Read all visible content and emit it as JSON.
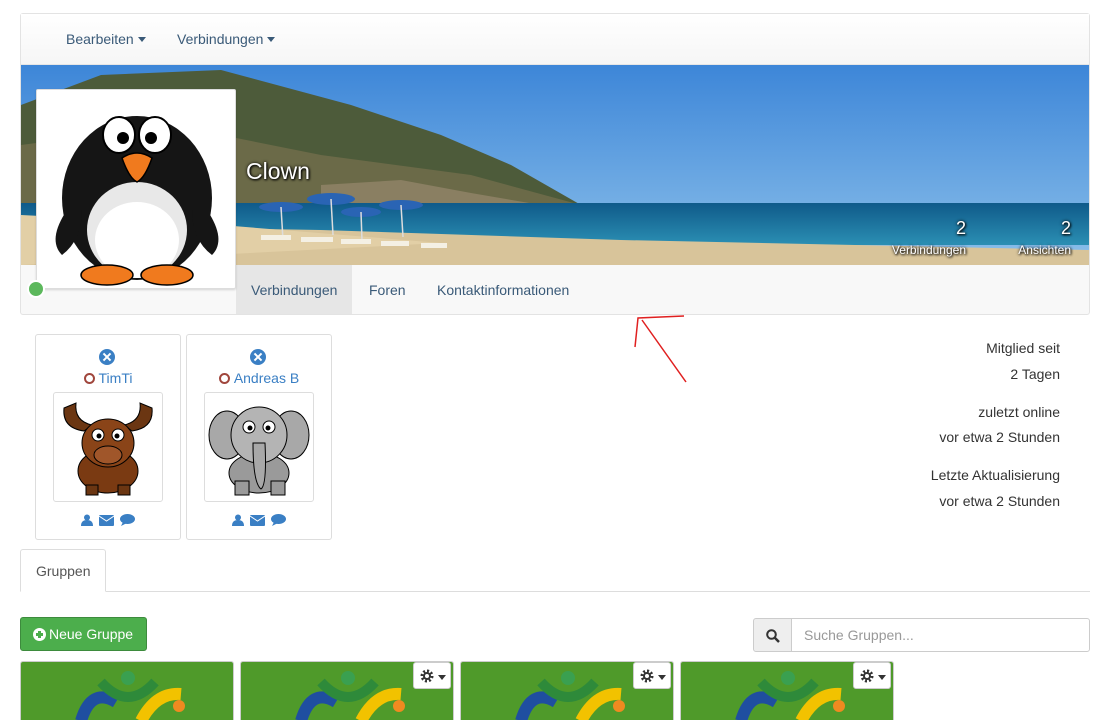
{
  "topmenu": {
    "edit_label": "Bearbeiten",
    "connections_label": "Verbindungen"
  },
  "profile": {
    "name": "Clown",
    "stats": [
      {
        "value": "2",
        "label": "Verbindungen"
      },
      {
        "value": "2",
        "label": "Ansichten"
      }
    ],
    "online_status_color": "#5cb85c"
  },
  "profile_tabs": [
    "Verbindungen",
    "Foren",
    "Kontaktinformationen"
  ],
  "connections": [
    {
      "name": "TimTi",
      "avatar": "moose"
    },
    {
      "name": "Andreas B",
      "avatar": "elephant"
    }
  ],
  "meta": {
    "member_since_label": "Mitglied seit",
    "member_since_value": "2 Tagen",
    "last_online_label": "zuletzt online",
    "last_online_value": "vor etwa 2 Stunden",
    "last_update_label": "Letzte Aktualisierung",
    "last_update_value": "vor etwa 2 Stunden"
  },
  "groups_tab": "Gruppen",
  "new_group_label": "Neue Gruppe",
  "search": {
    "placeholder": "Suche Gruppen..."
  },
  "colors": {
    "accent": "#3a7fc4",
    "success": "#4cae4c",
    "annotation": "#e02020"
  }
}
